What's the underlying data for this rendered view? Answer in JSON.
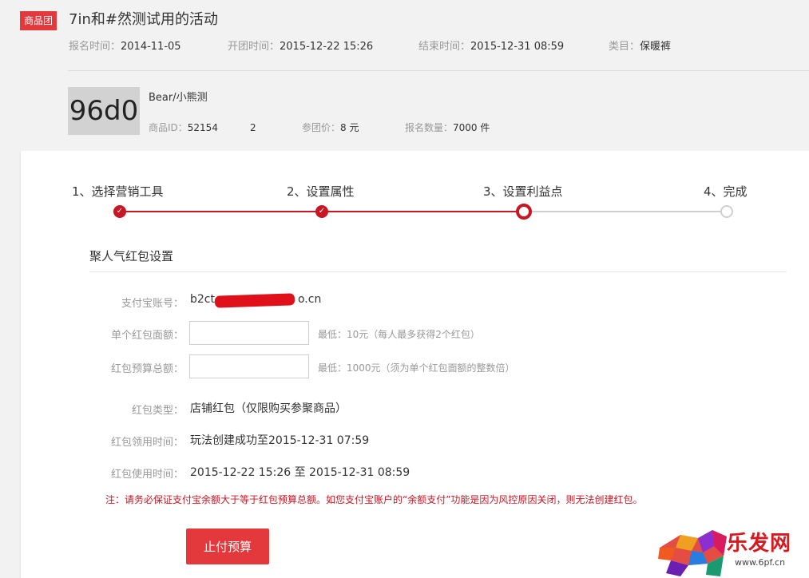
{
  "header": {
    "badge": "商品团",
    "title": "7in和#然测试用的活动",
    "signup_label": "报名时间：",
    "signup_value": "2014-11-05",
    "start_label": "开团时间：",
    "start_value": "2015-12-22 15:26",
    "end_label": "结束时间：",
    "end_value": "2015-12-31 08:59",
    "category_label": "类目：",
    "category_value": "保暖裤"
  },
  "product": {
    "thumb_text": "96d0",
    "name": "Bear/小熊测",
    "id_label": "商品ID：",
    "id_value": "52154",
    "id_suffix": "2",
    "price_label": "参团价：",
    "price_value": "8 元",
    "count_label": "报名数量：",
    "count_value": "7000 件"
  },
  "steps": [
    {
      "label": "1、选择营销工具",
      "state": "done"
    },
    {
      "label": "2、设置属性",
      "state": "done"
    },
    {
      "label": "3、设置利益点",
      "state": "active"
    },
    {
      "label": "4、完成",
      "state": "todo"
    }
  ],
  "colors": {
    "accent": "#c81623",
    "badge": "#e4393c",
    "track_todo": "#cfcfcf"
  },
  "section": {
    "title": "聚人气红包设置"
  },
  "form": {
    "alipay_label": "支付宝账号：",
    "alipay_value_start": "b2ct",
    "alipay_value_end": "o.cn",
    "single_label": "单个红包面额：",
    "single_value": "",
    "single_hint": "最低：10元（每人最多获得2个红包）",
    "budget_label": "红包预算总额：",
    "budget_value": "",
    "budget_hint": "最低：1000元（须为单个红包面额的整数倍）",
    "type_label": "红包类型：",
    "type_value": "店铺红包（仅限购买参聚商品）",
    "claim_label": "红包领用时间：",
    "claim_value": "玩法创建成功至2015-12-31 07:59",
    "use_label": "红包使用时间：",
    "use_value": "2015-12-22 15:26 至 2015-12-31 08:59"
  },
  "notice": "注：请务必保证支付宝余额大于等于红包预算总额。如您支付宝账户的“余额支付”功能是因为风控原因关闭，则无法创建红包。",
  "pay_button": "止付预算",
  "watermark": {
    "text": "乐发网",
    "url": "www.6pf.cn"
  }
}
